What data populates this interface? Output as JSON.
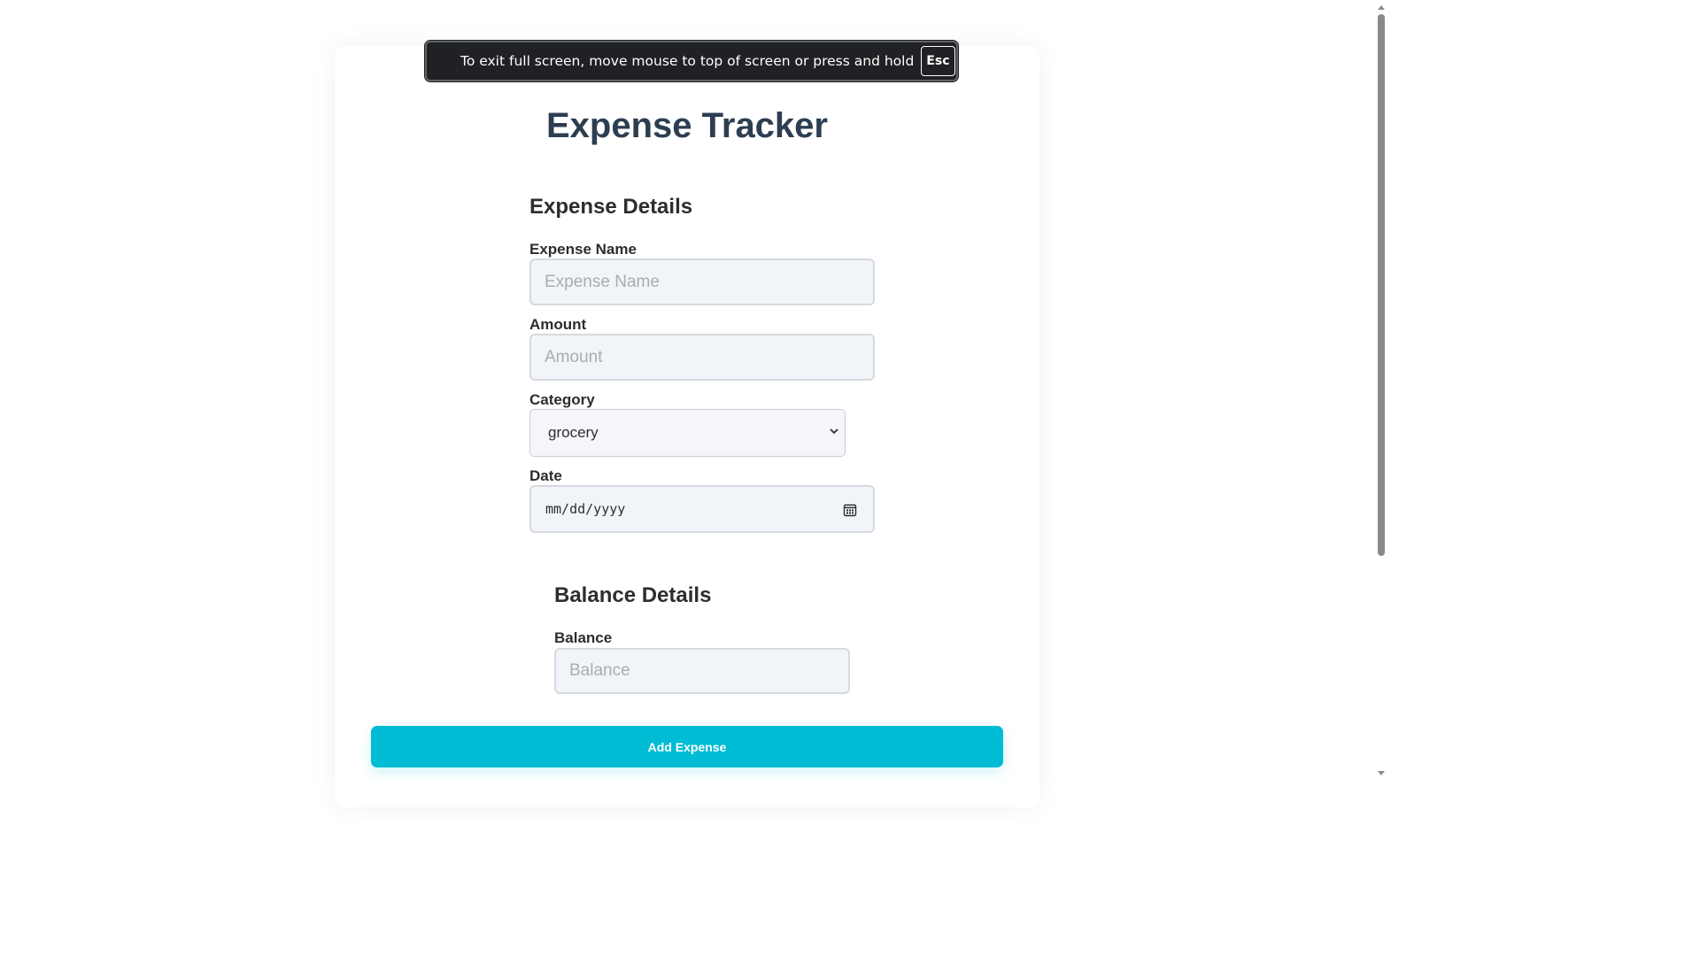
{
  "fullscreen_notice": {
    "text": "To exit full screen, move mouse to top of screen or press and hold",
    "key": "Esc"
  },
  "app": {
    "title": "Expense Tracker"
  },
  "expense_section": {
    "title": "Expense Details",
    "name_label": "Expense Name",
    "name_placeholder": "Expense Name",
    "amount_label": "Amount",
    "amount_placeholder": "Amount",
    "category_label": "Category",
    "category_value": "grocery",
    "date_label": "Date",
    "date_placeholder": "mm/dd/yyyy"
  },
  "balance_section": {
    "title": "Balance Details",
    "balance_label": "Balance",
    "balance_placeholder": "Balance"
  },
  "actions": {
    "add_label": "Add Expense"
  },
  "colors": {
    "accent": "#00bcd4",
    "title": "#2c3e50"
  }
}
